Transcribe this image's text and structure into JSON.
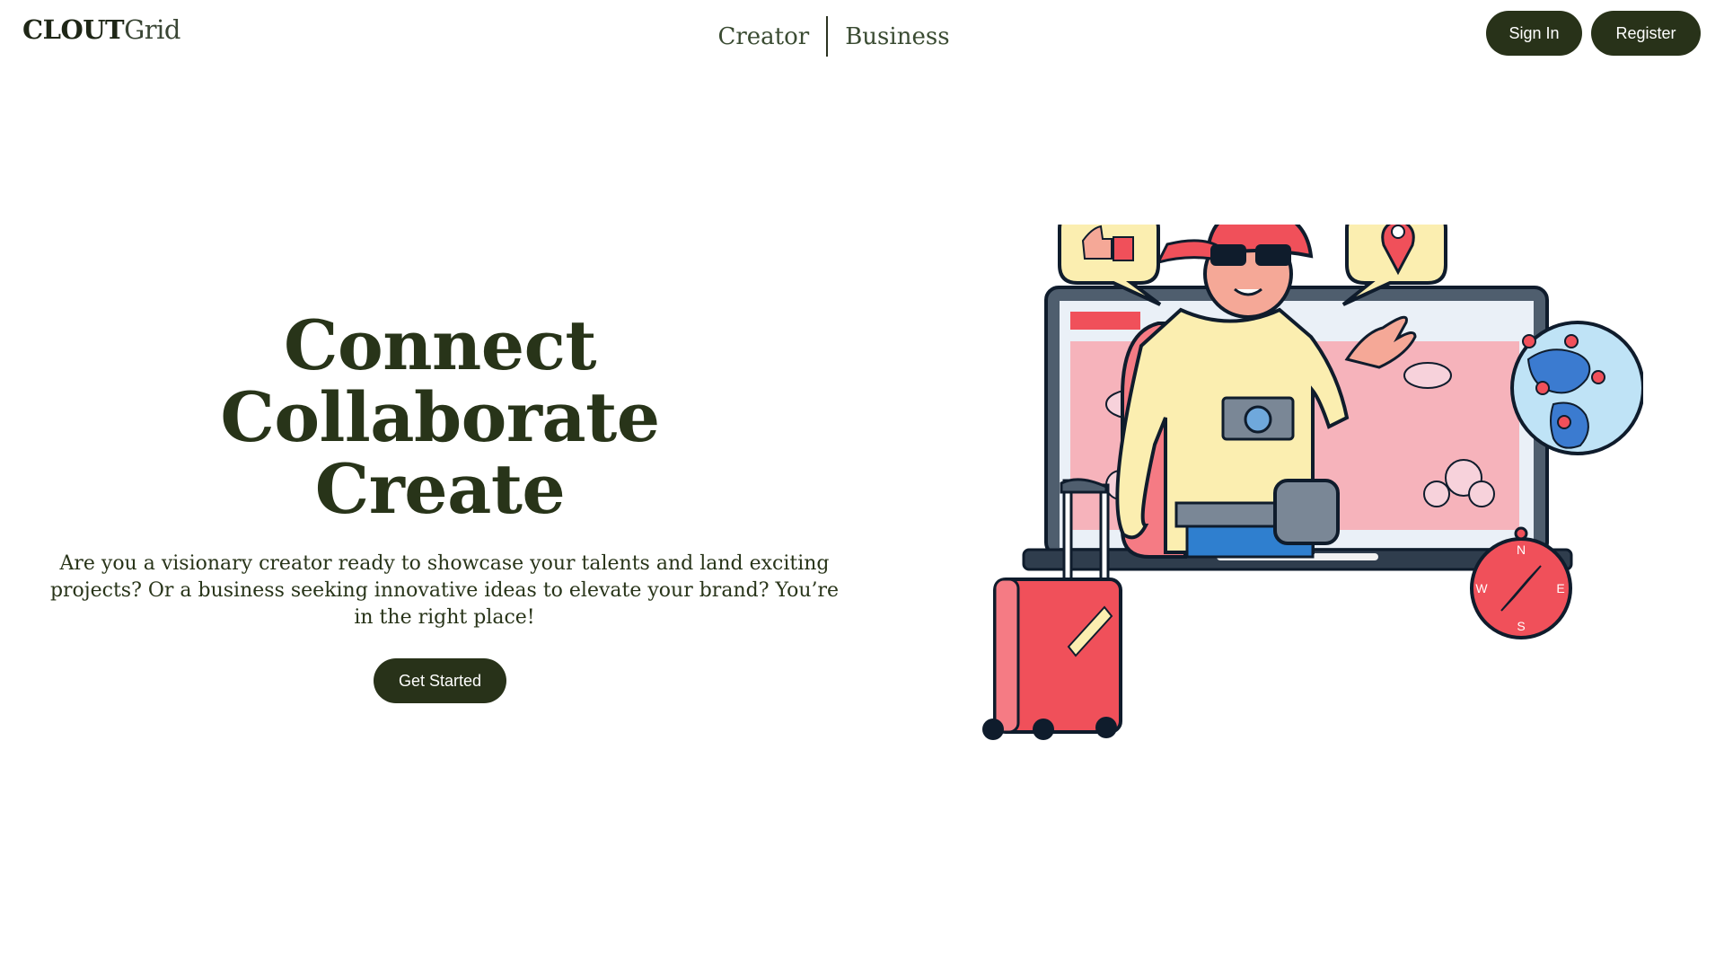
{
  "header": {
    "logo_bold": "CLOUTGrid",
    "logo_bold_part": "CLOUT",
    "logo_light_part": "Grid",
    "nav": [
      {
        "label": "Creator"
      },
      {
        "label": "Business"
      }
    ],
    "sign_in_label": "Sign In",
    "register_label": "Register"
  },
  "hero": {
    "lines": [
      "Connect",
      "Collaborate",
      "Create"
    ],
    "description": "Are you a visionary creator ready to showcase your talents and land exciting projects? Or a business seeking innovative ideas to elevate your brand? You’re in the right place!",
    "cta_label": "Get Started"
  },
  "illustration": {
    "compass_letters": [
      "N",
      "E",
      "S",
      "W"
    ]
  },
  "colors": {
    "primary": "#283219",
    "heading": "#283419",
    "accent_red": "#f0505a",
    "accent_yellow": "#fbeeb0"
  }
}
